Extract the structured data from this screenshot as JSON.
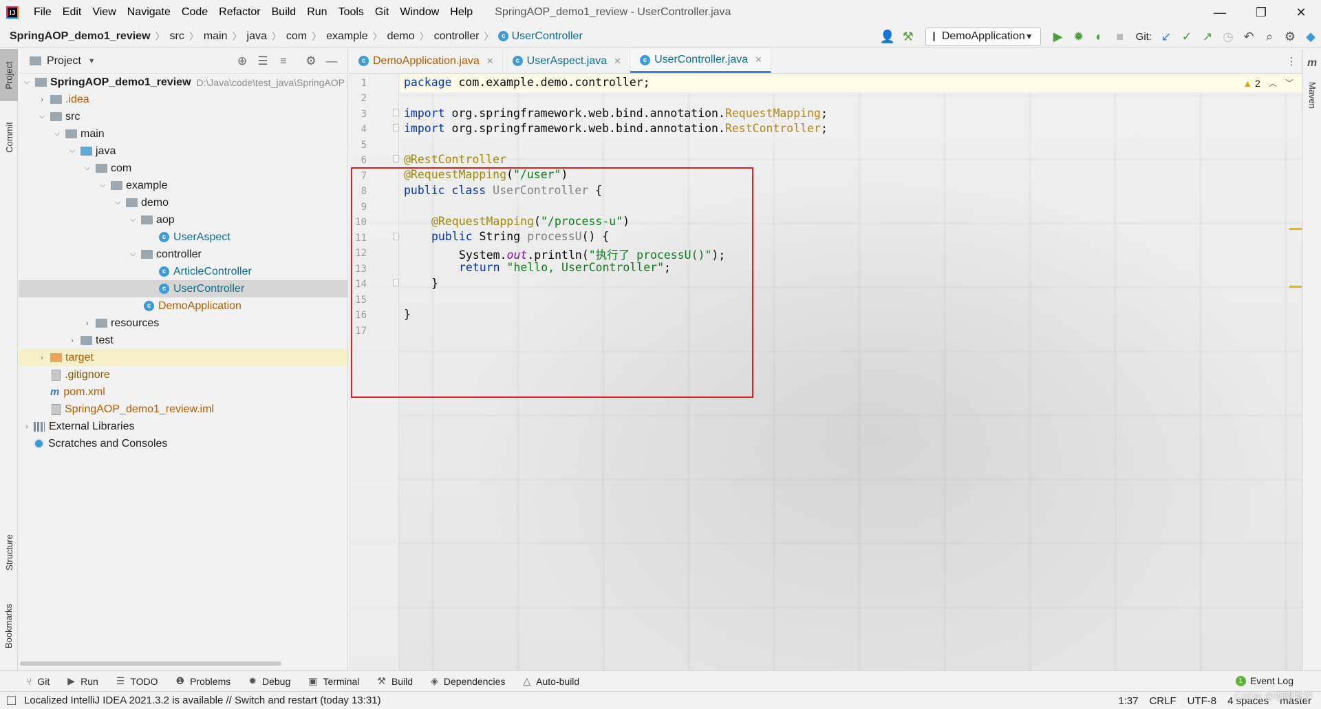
{
  "menu": [
    "File",
    "Edit",
    "View",
    "Navigate",
    "Code",
    "Refactor",
    "Build",
    "Run",
    "Tools",
    "Git",
    "Window",
    "Help"
  ],
  "window_title": "SpringAOP_demo1_review - UserController.java",
  "window_controls": {
    "minimize": "—",
    "restore": "❐",
    "close": "✕"
  },
  "breadcrumbs": [
    "SpringAOP_demo1_review",
    "src",
    "main",
    "java",
    "com",
    "example",
    "demo",
    "controller",
    "UserController"
  ],
  "toolbar": {
    "run_config": "DemoApplication",
    "git_label": "Git:"
  },
  "left_strip": {
    "project": "Project",
    "commit": "Commit",
    "structure": "Structure",
    "bookmarks": "Bookmarks"
  },
  "project_panel": {
    "title": "Project",
    "tree": [
      {
        "label": "SpringAOP_demo1_review",
        "path": "D:\\Java\\code\\test_java\\SpringAOP"
      },
      {
        "label": ".idea"
      },
      {
        "label": "src"
      },
      {
        "label": "main"
      },
      {
        "label": "java"
      },
      {
        "label": "com"
      },
      {
        "label": "example"
      },
      {
        "label": "demo"
      },
      {
        "label": "aop"
      },
      {
        "label": "UserAspect"
      },
      {
        "label": "controller"
      },
      {
        "label": "ArticleController"
      },
      {
        "label": "UserController"
      },
      {
        "label": "DemoApplication"
      },
      {
        "label": "resources"
      },
      {
        "label": "test"
      },
      {
        "label": "target"
      },
      {
        "label": ".gitignore"
      },
      {
        "label": "pom.xml"
      },
      {
        "label": "SpringAOP_demo1_review.iml"
      },
      {
        "label": "External Libraries"
      },
      {
        "label": "Scratches and Consoles"
      }
    ]
  },
  "editor_tabs": [
    {
      "label": "DemoApplication.java"
    },
    {
      "label": "UserAspect.java"
    },
    {
      "label": "UserController.java"
    }
  ],
  "editor": {
    "line_numbers": [
      "1",
      "2",
      "3",
      "4",
      "5",
      "6",
      "7",
      "8",
      "9",
      "10",
      "11",
      "12",
      "13",
      "14",
      "15",
      "16",
      "17"
    ],
    "warnings": "2",
    "code": {
      "l1_kw": "package",
      "l1_rest": " com.example.demo.controller;",
      "l3_kw": "import",
      "l3_pkg": " org.springframework.web.bind.annotation.",
      "l3_cls": "RequestMapping",
      "l3_end": ";",
      "l4_kw": "import",
      "l4_pkg": " org.springframework.web.bind.annotation.",
      "l4_cls": "RestController",
      "l4_end": ";",
      "l6_ann": "@RestController",
      "l7_ann": "@RequestMapping",
      "l7_open": "(",
      "l7_str": "\"/user\"",
      "l7_close": ")",
      "l8_kw": "public class",
      "l8_cls": " UserController",
      "l8_end": " {",
      "l10_ann": "@RequestMapping",
      "l10_open": "(",
      "l10_str": "\"/process-u\"",
      "l10_close": ")",
      "l11_kw": "public",
      "l11_type": " String ",
      "l11_name": "processU",
      "l11_end": "() {",
      "l12_a": "System.",
      "l12_fld": "out",
      "l12_b": ".println(",
      "l12_str": "\"执行了 processU()\"",
      "l12_end": ");",
      "l13_kw": "return",
      "l13_str": " \"hello, UserController\"",
      "l13_end": ";",
      "l14": "}",
      "l16": "}"
    }
  },
  "right_strip": {
    "maven": "Maven"
  },
  "tool_windows": [
    "Git",
    "Run",
    "TODO",
    "Problems",
    "Debug",
    "Terminal",
    "Build",
    "Dependencies",
    "Auto-build"
  ],
  "event_log": {
    "badge": "1",
    "label": "Event Log"
  },
  "status": {
    "message": "Localized IntelliJ IDEA 2021.3.2 is available // Switch and restart (today 13:31)",
    "position": "1:37",
    "line_sep": "CRLF",
    "encoding": "UTF-8",
    "indent": "4 spaces",
    "branch": "master"
  },
  "watermark": "CSDN @咖啡唯尔"
}
